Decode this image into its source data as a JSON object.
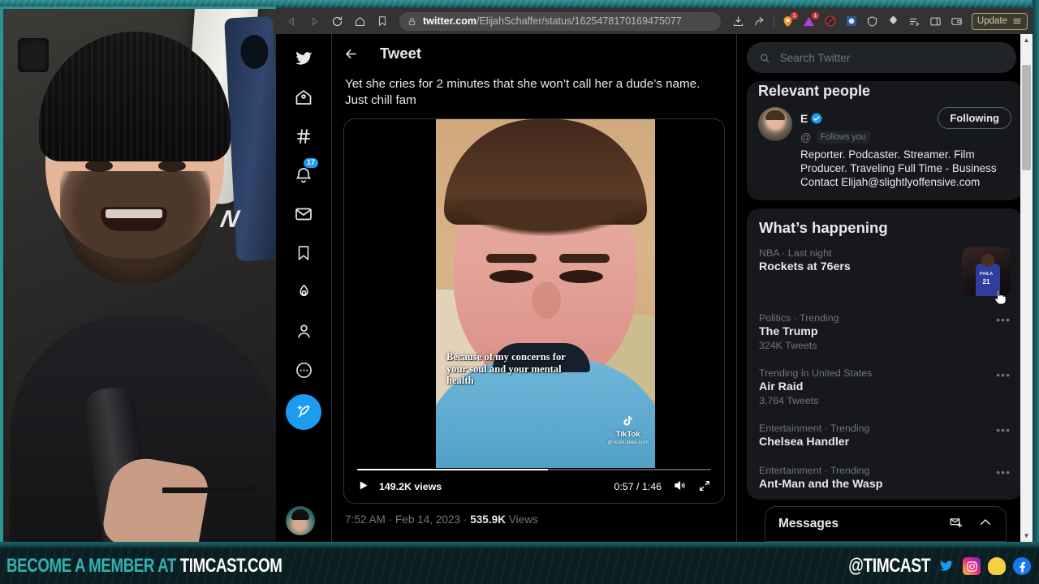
{
  "browser": {
    "url_domain": "twitter.com",
    "url_path": "/ElijahSchaffer/status/1625478170169475077",
    "update_label": "Update",
    "nav": {
      "back": "back-arrow",
      "forward": "forward-arrow",
      "reload": "reload",
      "home": "home",
      "bookmark": "bookmark"
    },
    "ext_badges": [
      "1",
      "1"
    ]
  },
  "twitter": {
    "header_title": "Tweet",
    "tweet_text": "Yet she cries for 2 minutes that she won’t call her a dude’s name. Just chill fam",
    "meta_time": "7:52 AM",
    "meta_date": "Feb 14, 2023",
    "meta_views_count": "535.9K",
    "meta_views_label": "Views",
    "nav_items": [
      {
        "name": "home-icon",
        "label": "Home"
      },
      {
        "name": "explore-icon",
        "label": "Explore"
      },
      {
        "name": "notifications-icon",
        "label": "Notifications",
        "badge": "17"
      },
      {
        "name": "messages-icon",
        "label": "Messages"
      },
      {
        "name": "bookmarks-icon",
        "label": "Bookmarks"
      },
      {
        "name": "twitter-blue-icon",
        "label": "Twitter Blue"
      },
      {
        "name": "profile-icon",
        "label": "Profile"
      },
      {
        "name": "more-icon",
        "label": "More"
      }
    ],
    "video": {
      "views_label": "149.2K views",
      "current_time": "0:57",
      "total_time": "1:46",
      "timecode": "0:57 / 1:46",
      "progress_percent": 54,
      "caption": "Because of my concerns for your soul and your mental health",
      "watermark_name": "TikTok",
      "watermark_handle": "@ kore.likes.com"
    },
    "search": {
      "placeholder": "Search Twitter",
      "value": ""
    },
    "relevant_people": {
      "heading": "Relevant people",
      "name": "E",
      "handle": "@",
      "follows_you": "Follows you",
      "follow_button": "Following",
      "bio": "Reporter. Podcaster. Streamer. Film Producer. Traveling Full Time - Business Contact Elijah@slightlyoffensive.com"
    },
    "whats_happening": {
      "heading": "What’s happening",
      "items": [
        {
          "category": "NBA · Last night",
          "name": "Rockets at 76ers",
          "count": "",
          "has_thumb": true,
          "thumb_team": "PHILA",
          "thumb_number": "21"
        },
        {
          "category": "Politics · Trending",
          "name": "The Trump",
          "count": "324K Tweets",
          "has_thumb": false
        },
        {
          "category": "Trending in United States",
          "name": "Air Raid",
          "count": "3,764 Tweets",
          "has_thumb": false
        },
        {
          "category": "Entertainment · Trending",
          "name": "Chelsea Handler",
          "count": "",
          "has_thumb": false
        },
        {
          "category": "Entertainment · Trending",
          "name": "Ant-Man and the Wasp",
          "count": "",
          "has_thumb": false
        }
      ]
    },
    "messages_dock": {
      "title": "Messages",
      "new_message_icon": "new-message-icon",
      "expand_icon": "chevron-up-icon"
    }
  },
  "banner": {
    "left_prefix": "BECOME A MEMBER AT ",
    "left_brand": "TIMCAST.COM",
    "handle": "@TIMCAST",
    "socials": [
      "twitter-icon",
      "instagram-icon",
      "minds-icon",
      "facebook-icon"
    ]
  },
  "colors": {
    "twitter_blue": "#1d9bf0",
    "banner_teal": "#2fb3ae",
    "frame_teal": "#2b9596",
    "card_bg": "#16181c",
    "muted_text": "#71767b"
  }
}
